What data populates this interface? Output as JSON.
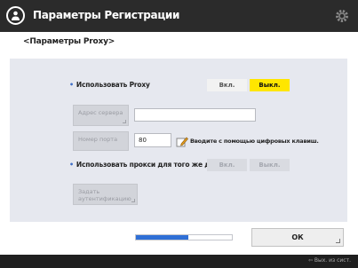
{
  "titlebar": {
    "title": "Параметры Регистрации",
    "app_icon": "settings-user-icon",
    "settings_icon": "gear-icon"
  },
  "subtitle": "<Параметры Proxy>",
  "use_proxy": {
    "label": "Использовать Proxy",
    "on": "Вкл.",
    "off": "Выкл.",
    "selected": "off"
  },
  "server_address": {
    "button": "Адрес сервера",
    "value": ""
  },
  "port_number": {
    "button": "Номер порта",
    "value": "80",
    "hint": "Вводите с помощью цифровых клавиш."
  },
  "same_proxy_domain": {
    "label": "Использовать прокси для того же домена",
    "on": "Вкл.",
    "off": "Выкл."
  },
  "auth_settings": {
    "button": "Задать аутентификацию"
  },
  "progress": {
    "fraction": 0.55
  },
  "ok_button": "ОК",
  "status": "Вых. из сист.",
  "colors": {
    "accent": "#ffe600",
    "titlebar": "#2b2b2b",
    "panel": "#e6e8ef",
    "progress": "#2f6fd6"
  }
}
